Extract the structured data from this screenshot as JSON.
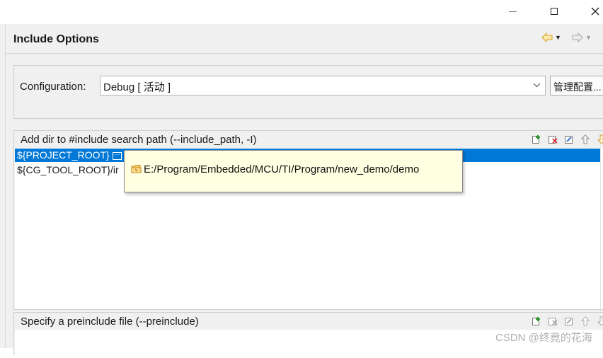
{
  "window": {
    "minimize_icon": "minimize-icon",
    "maximize_icon": "maximize-icon",
    "close_icon": "close-icon"
  },
  "header": {
    "title": "Include Options",
    "back_icon": "arrow-left-icon",
    "forward_icon": "arrow-right-icon"
  },
  "configuration": {
    "label": "Configuration:",
    "value": "Debug  [ 活动 ]",
    "manage_button": "管理配置..."
  },
  "include_paths": {
    "title": "Add dir to #include search path (--include_path, -I)",
    "items": [
      {
        "label": "${PROJECT_ROOT}",
        "selected": true
      },
      {
        "label": "${CG_TOOL_ROOT}/ir",
        "selected": false
      }
    ],
    "toolbar_icons": [
      "add-icon",
      "delete-icon",
      "edit-icon",
      "move-up-icon",
      "move-down-icon"
    ]
  },
  "tooltip": {
    "text": "E:/Program/Embedded/MCU/TI/Program/new_demo/demo",
    "icon": "folder-icon"
  },
  "preinclude": {
    "title": "Specify a preinclude file (--preinclude)"
  },
  "watermark": "CSDN @终竟的花海",
  "colors": {
    "selection": "#0078d7",
    "tooltip_bg": "#ffffe1",
    "panel_bg": "#f0f0f0",
    "nav_arrow": "#e8b84a"
  }
}
